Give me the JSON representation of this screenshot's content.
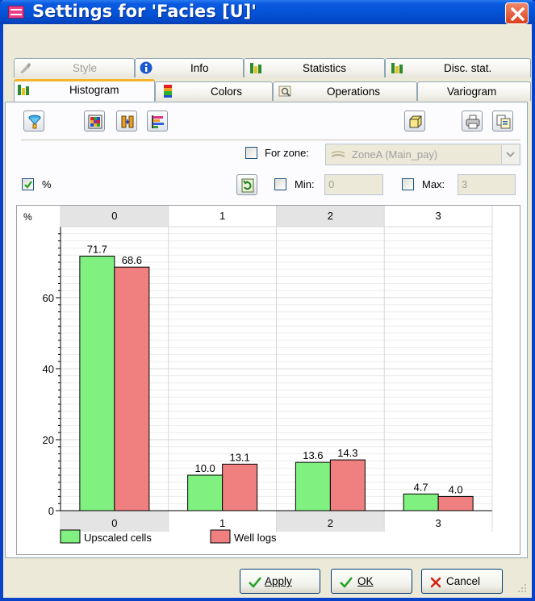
{
  "window": {
    "title": "Settings for 'Facies [U]'"
  },
  "tabs_row1": [
    {
      "label": "Style",
      "disabled": true,
      "icon": "brush-icon"
    },
    {
      "label": "Info",
      "icon": "info-icon"
    },
    {
      "label": "Statistics",
      "icon": "bar-chart-icon"
    },
    {
      "label": "Disc. stat.",
      "icon": "bar-chart-icon"
    }
  ],
  "tabs_row2": [
    {
      "label": "Histogram",
      "active": true,
      "icon": "histogram-icon"
    },
    {
      "label": "Colors",
      "icon": "color-table-icon"
    },
    {
      "label": "Operations",
      "icon": "magnifier-icon"
    },
    {
      "label": "Variogram"
    }
  ],
  "toolbar": {
    "left_icons": [
      "filter-icon",
      "grid-table-icon",
      "compare-bars-icon",
      "horizontal-bars-icon"
    ],
    "right_icons": [
      "cube-icon",
      "print-icon",
      "copy-icon"
    ]
  },
  "zone": {
    "label": "For zone:",
    "checked": false,
    "value": "ZoneA (Main_pay)"
  },
  "percent": {
    "label": "%",
    "checked": true
  },
  "min": {
    "label": "Min:",
    "checked": false,
    "value": "0"
  },
  "max": {
    "label": "Max:",
    "checked": false,
    "value": "3"
  },
  "colors": {
    "series1": "#80f080",
    "series2": "#f08080",
    "accent": "#0842c8"
  },
  "chart_data": {
    "type": "bar",
    "categories": [
      "0",
      "1",
      "2",
      "3"
    ],
    "series": [
      {
        "name": "Upscaled cells",
        "values": [
          71.7,
          10.0,
          13.6,
          4.7
        ],
        "labels": [
          "71.7",
          "10.0",
          "13.6",
          "4.7"
        ]
      },
      {
        "name": "Well logs",
        "values": [
          68.6,
          13.1,
          14.3,
          4.0
        ],
        "labels": [
          "68.6",
          "13.1",
          "14.3",
          "4.0"
        ]
      }
    ],
    "ylabel": "%",
    "yticks": [
      "0",
      "20",
      "40",
      "60"
    ],
    "ylim": [
      0,
      80
    ],
    "grid": true,
    "legend": "bottom-left"
  },
  "buttons": {
    "apply": "Apply",
    "ok": "OK",
    "cancel": "Cancel"
  }
}
